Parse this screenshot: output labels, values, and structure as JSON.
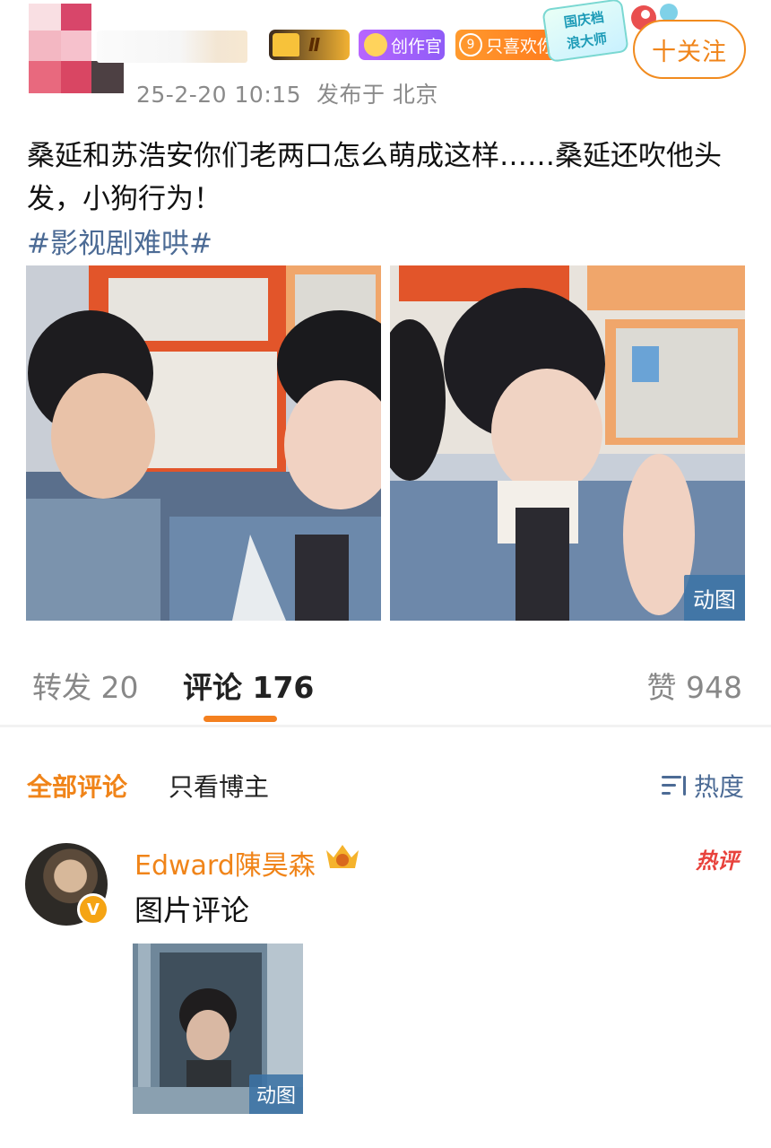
{
  "post": {
    "timestamp": "25-2-20 10:15",
    "location": "发布于 北京",
    "follow_label": "十关注",
    "badges": {
      "vip_level": "Ⅱ",
      "creator": "创作官",
      "fan_level": "9",
      "fan_label": "只喜欢你",
      "festival": [
        "国庆档",
        "浪大师"
      ]
    },
    "text": "桑延和苏浩安你们老两口怎么萌成这样……桑延还吹他头发，小狗行为！",
    "hashtag": "#影视剧难哄#",
    "images": [
      {
        "type": "image",
        "gif_label": ""
      },
      {
        "type": "gif",
        "gif_label": "动图"
      }
    ]
  },
  "tabs": {
    "repost": "转发 20",
    "comment": "评论 176",
    "like": "赞 948"
  },
  "filters": {
    "all": "全部评论",
    "owner_only": "只看博主",
    "sort": "热度"
  },
  "comment": {
    "username": "Edward陳昊森",
    "verified": "V",
    "hot_tag": "热评",
    "text": "图片评论",
    "image_label": "动图"
  },
  "colors": {
    "accent": "#f08419",
    "link": "#4c6b95",
    "hot": "#e8423c",
    "gif_tag": "#3c73a5"
  }
}
